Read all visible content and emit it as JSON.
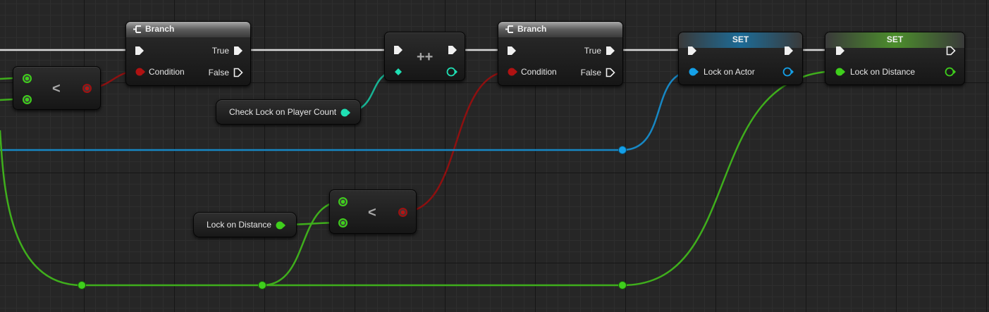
{
  "graph": {
    "branch_1": {
      "title": "Branch",
      "true_label": "True",
      "false_label": "False",
      "condition_label": "Condition"
    },
    "branch_2": {
      "title": "Branch",
      "true_label": "True",
      "false_label": "False",
      "condition_label": "Condition"
    },
    "compare_1": {
      "operator": "<"
    },
    "compare_2": {
      "operator": "<"
    },
    "increment": {
      "operator": "++"
    },
    "get_player_count": {
      "label": "Check Lock on Player Count"
    },
    "get_lock_distance": {
      "label": "Lock on Distance"
    },
    "set_actor": {
      "title": "SET",
      "input_label": "Lock on Actor"
    },
    "set_distance": {
      "title": "SET",
      "input_label": "Lock on Distance"
    }
  },
  "colors": {
    "exec": "#e8e8e8",
    "bool": "#920101",
    "int": "#1fe0b4",
    "float": "#39d11b",
    "object": "#0fa2e6"
  }
}
